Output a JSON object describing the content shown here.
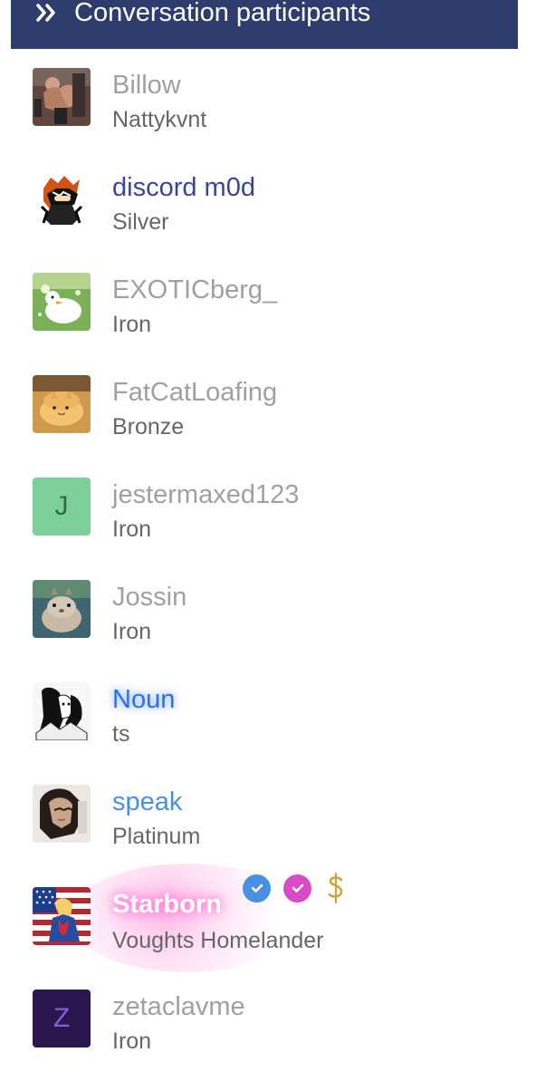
{
  "panel": {
    "title": "Conversation participants"
  },
  "participants": [
    {
      "name": "Billow",
      "subtitle": "Nattykvnt"
    },
    {
      "name": "discord m0d",
      "subtitle": "Silver"
    },
    {
      "name": "EXOTICberg_",
      "subtitle": "Iron"
    },
    {
      "name": "FatCatLoafing",
      "subtitle": "Bronze"
    },
    {
      "name": "jestermaxed123",
      "subtitle": "Iron",
      "avatar_letter": "J"
    },
    {
      "name": "Jossin",
      "subtitle": "Iron"
    },
    {
      "name": "Noun",
      "subtitle": "ts"
    },
    {
      "name": "speak",
      "subtitle": "Platinum"
    },
    {
      "name": "Starborn",
      "subtitle": "Voughts Homelander"
    },
    {
      "name": "zetaclavme",
      "subtitle": "Iron",
      "avatar_letter": "Z"
    }
  ],
  "icons": {
    "header": "double-chevron-right-icon",
    "badge_1": "verified-check-icon",
    "badge_2": "verified-check-icon",
    "badge_3": "dollar-icon"
  },
  "colors": {
    "header_bg": "#2f3d6e",
    "name_gray": "#a0a0a0",
    "name_purple": "#3545a0",
    "name_blue": "#4a90e2",
    "accent_pink": "#d74cc5",
    "avatar_green": "#7ed09b",
    "avatar_purple": "#2b1750"
  }
}
